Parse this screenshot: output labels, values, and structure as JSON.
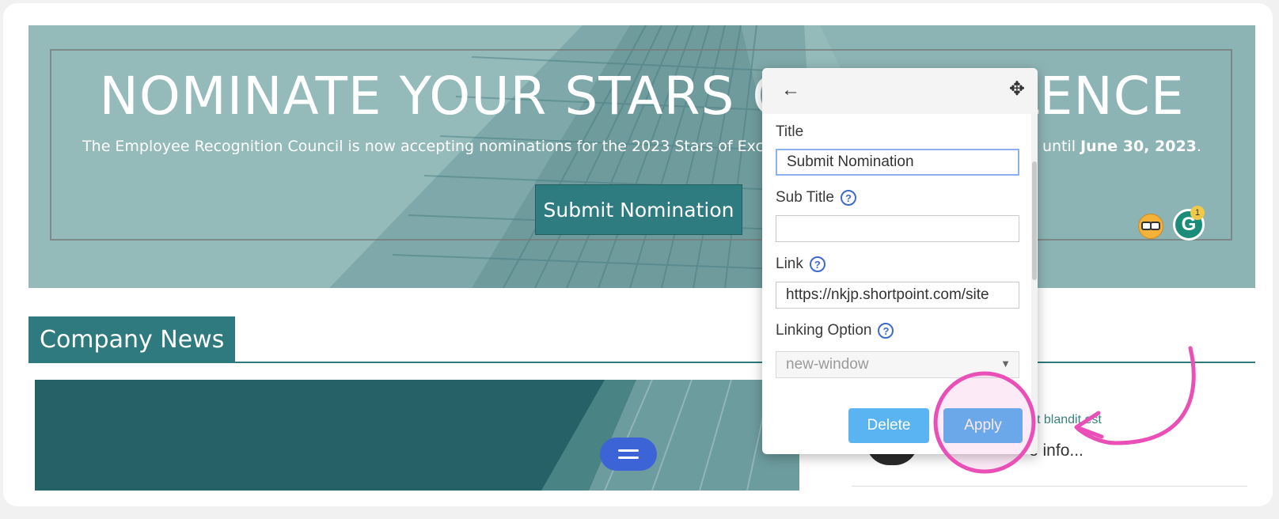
{
  "hero": {
    "title": "NOMINATE YOUR STARS OF EXCELLENCE",
    "subtitle_pre": "The Employee Recognition Council is now accepting nominations for the 2023 Stars of Excellence",
    "subtitle_gap": "                                              ",
    "subtitle_post": " until ",
    "subtitle_date": "June 30, 2023",
    "subtitle_end": ".",
    "button_label": "Submit Nomination"
  },
  "floating_icons": {
    "grammarly_letter": "G",
    "grammarly_badge": "1"
  },
  "news": {
    "header": "Company News",
    "snippet": "t blandit est",
    "read_more": "e info..."
  },
  "panel": {
    "back_icon": "←",
    "move_icon": "✥",
    "title_label": "Title",
    "title_value": "Submit Nomination",
    "subtitle_label": "Sub Title",
    "subtitle_value": "",
    "link_label": "Link",
    "link_value": "https://nkjp.shortpoint.com/site",
    "linking_label": "Linking Option",
    "linking_value": "new-window",
    "help_glyph": "?",
    "delete_label": "Delete",
    "apply_label": "Apply"
  },
  "colors": {
    "accent_teal": "#2e7a7e",
    "button_blue": "#5ab4f2",
    "annotation_pink": "#e94fb6"
  }
}
